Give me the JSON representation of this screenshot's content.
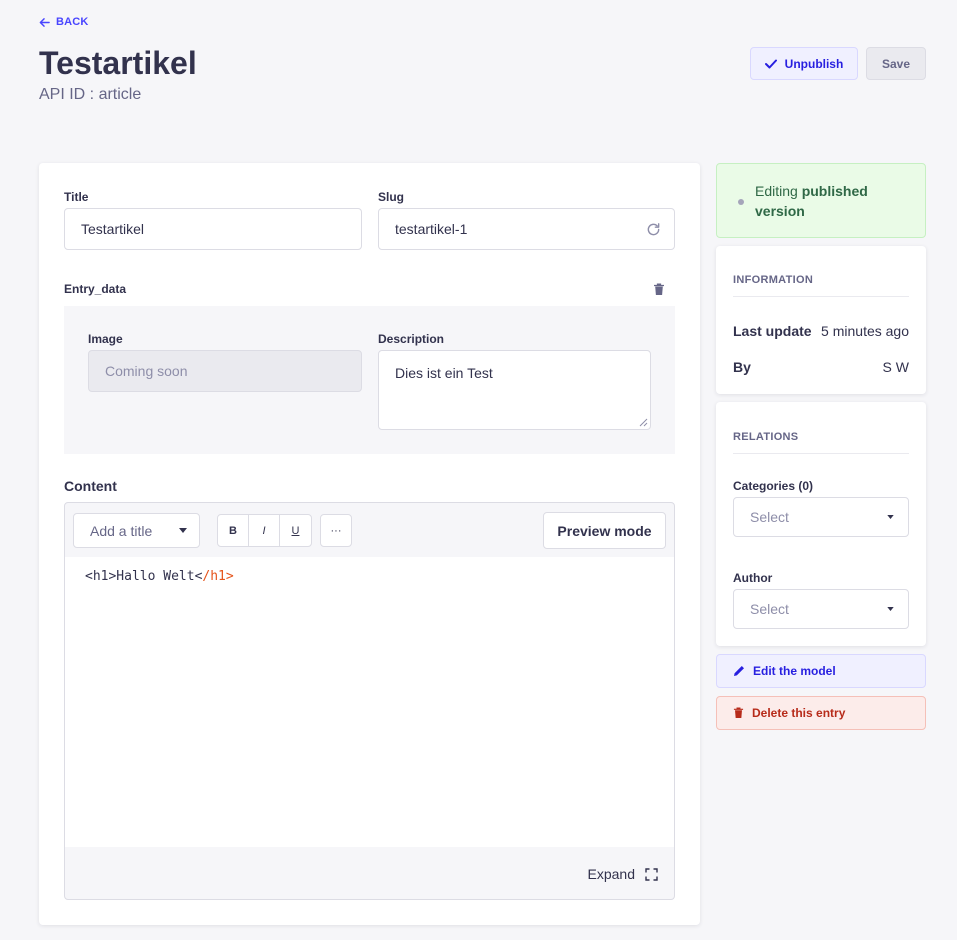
{
  "header": {
    "back_label": "BACK",
    "title": "Testartikel",
    "api_id": "API ID : article",
    "unpublish_label": "Unpublish",
    "save_label": "Save"
  },
  "form": {
    "title_label": "Title",
    "title_value": "Testartikel",
    "slug_label": "Slug",
    "slug_value": "testartikel-1",
    "component_label": "Entry_data",
    "image_label": "Image",
    "image_placeholder": "Coming soon",
    "description_label": "Description",
    "description_value": "Dies ist ein Test",
    "content_label": "Content",
    "editor": {
      "title_select": "Add a title",
      "bold": "B",
      "italic": "I",
      "underline": "U",
      "more": "···",
      "preview_label": "Preview mode",
      "code_open": "<h1>Hallo Welt<",
      "code_close": "/h1>",
      "expand_label": "Expand"
    }
  },
  "sidebar": {
    "status_prefix": "Editing ",
    "status_strong": "published",
    "status_suffix": "version",
    "information": {
      "title": "INFORMATION",
      "last_update_label": "Last update",
      "last_update_value": "5 minutes ago",
      "by_label": "By",
      "by_value": "S W"
    },
    "relations": {
      "title": "RELATIONS",
      "categories_label": "Categories (0)",
      "categories_placeholder": "Select",
      "author_label": "Author",
      "author_placeholder": "Select"
    },
    "edit_model_label": "Edit the model",
    "delete_label": "Delete this entry"
  },
  "colors": {
    "primary": "#4945ff",
    "success_bg": "#eafbe7",
    "danger": "#b72b1a",
    "code_tag": "#e5541b"
  }
}
